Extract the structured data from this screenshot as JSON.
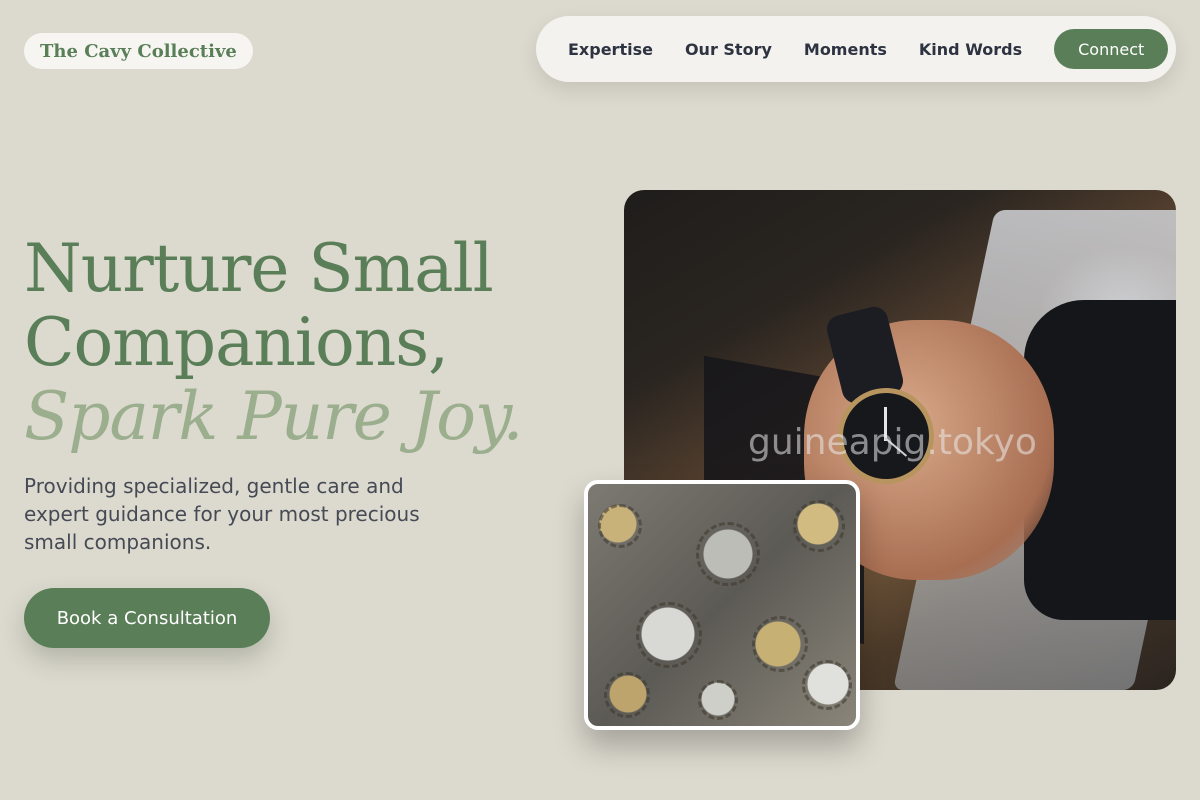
{
  "brand": {
    "name": "The Cavy Collective"
  },
  "nav": {
    "links": [
      "Expertise",
      "Our Story",
      "Moments",
      "Kind Words"
    ],
    "cta": "Connect"
  },
  "hero": {
    "title_line1": "Nurture Small",
    "title_line2": "Companions,",
    "title_accent": "Spark Pure Joy.",
    "subtitle": "Providing specialized, gentle care and expert guidance for your most precious small companions.",
    "button": "Book a Consultation"
  },
  "images": {
    "main_watermark": "guineapig.tokyo"
  },
  "colors": {
    "background": "#dcd9ce",
    "accent": "#5a7f58",
    "accent_light": "#9bae8e"
  }
}
